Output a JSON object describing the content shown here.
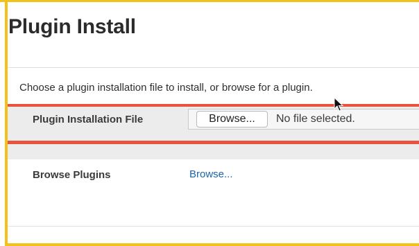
{
  "header": {
    "title": "Plugin Install"
  },
  "description": "Choose a plugin installation file to install, or browse for a plugin.",
  "plugin_file": {
    "label": "Plugin Installation File",
    "button_label": "Browse...",
    "status": "No file selected."
  },
  "browse_plugins": {
    "label": "Browse Plugins",
    "link_label": "Browse..."
  },
  "colors": {
    "highlight_frame": "#f2c21a",
    "highlight_row": "#e8533f",
    "link": "#1a64a8"
  },
  "icons": {
    "cursor": "mouse-pointer-icon"
  }
}
